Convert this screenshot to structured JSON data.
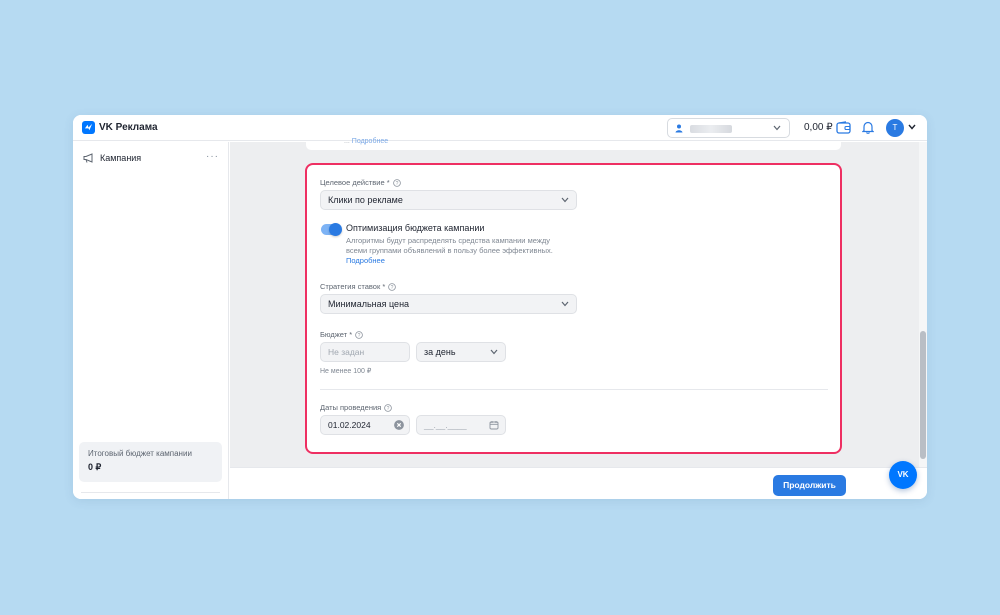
{
  "app": {
    "title": "VK Реклама"
  },
  "header": {
    "account_selector": {
      "value": ""
    },
    "balance": "0,00 ₽",
    "avatar_initial": "Т"
  },
  "sidebar": {
    "items": [
      {
        "label": "Кампания",
        "more": "···"
      }
    ],
    "budget": {
      "label": "Итоговый бюджет кампании",
      "value": "0 ₽"
    }
  },
  "form": {
    "top_hint": {
      "text": "...",
      "link": "Подробнее"
    },
    "target_action": {
      "label": "Целевое действие *",
      "value": "Клики по рекламе"
    },
    "budget_optimization": {
      "title": "Оптимизация бюджета кампании",
      "description": "Алгоритмы будут распределять средства кампании между всеми группами объявлений в пользу более эффективных.",
      "link": "Подробнее",
      "enabled": true
    },
    "bid_strategy": {
      "label": "Стратегия ставок *",
      "value": "Минимальная цена"
    },
    "budget": {
      "label": "Бюджет *",
      "placeholder": "Не задан",
      "period": "за день",
      "hint": "Не менее 100 ₽"
    },
    "dates": {
      "label": "Даты проведения",
      "start": "01.02.2024",
      "end_placeholder": "__.__.____"
    }
  },
  "footer": {
    "continue_label": "Продолжить"
  },
  "fab": {
    "label": "VK"
  },
  "colors": {
    "accent": "#2a7ae2",
    "highlight": "#ee2f62",
    "background": "#b6daf2"
  }
}
